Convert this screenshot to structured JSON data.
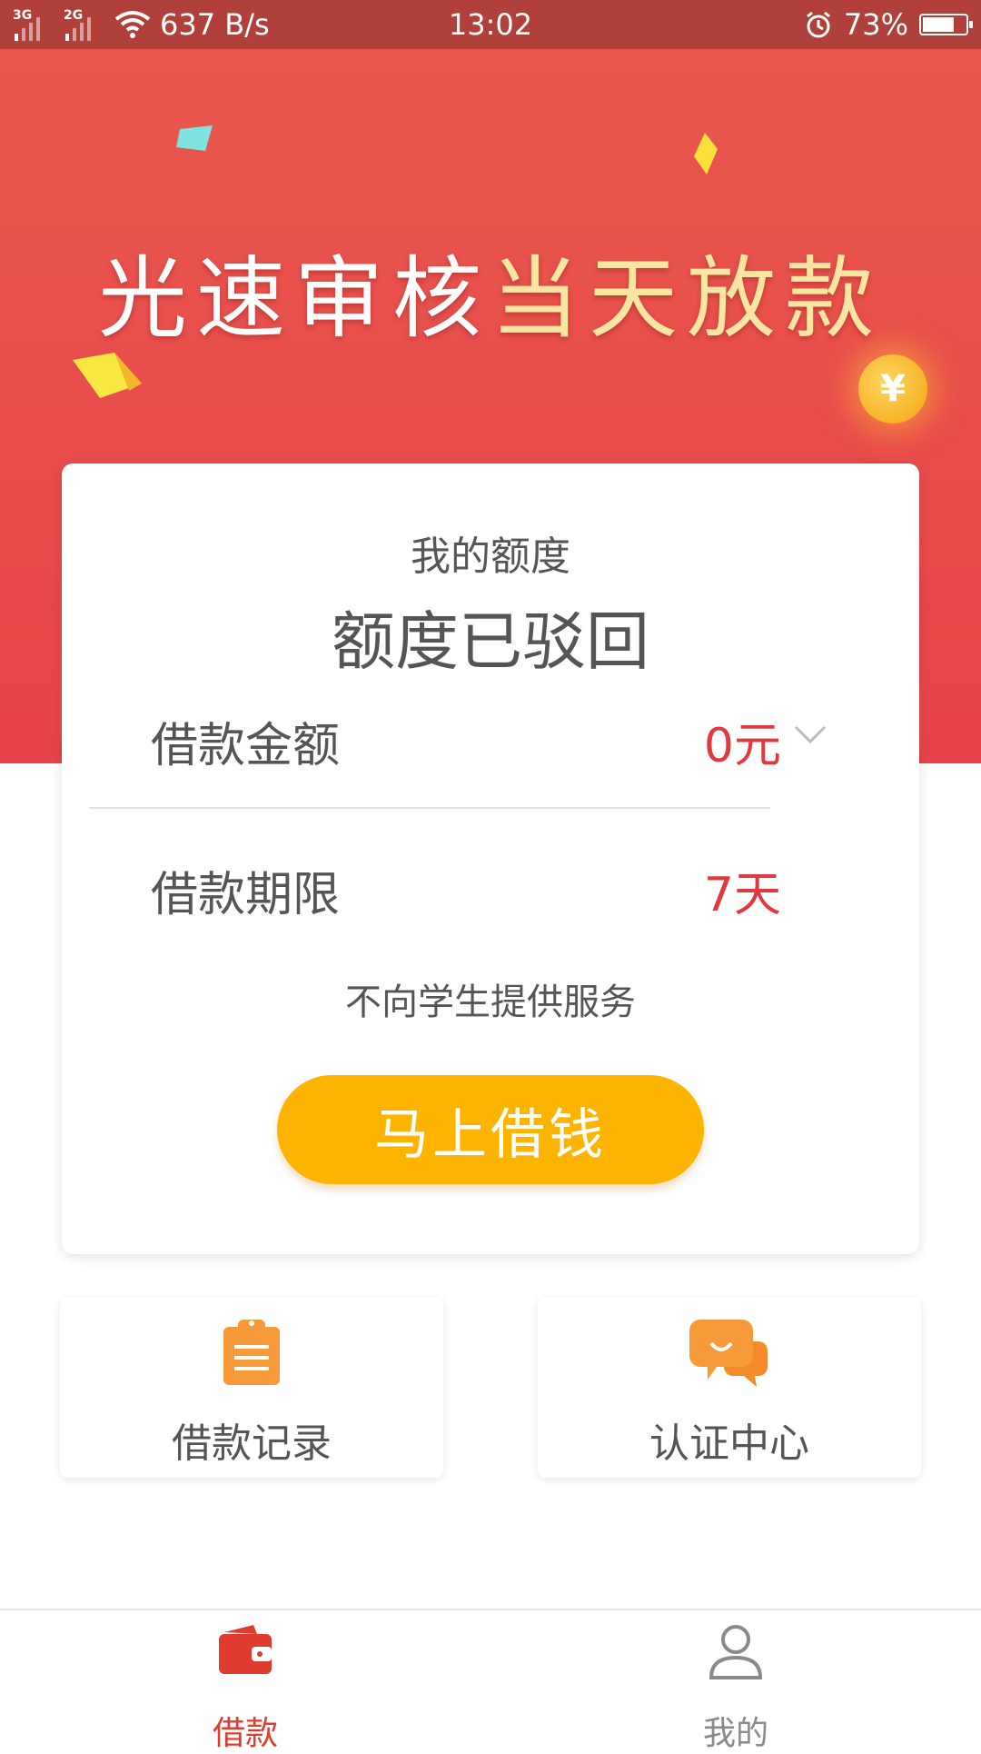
{
  "status_bar": {
    "network_a": "3G",
    "network_b": "2G",
    "speed": "637 B/s",
    "time": "13:02",
    "battery": "73%",
    "battery_level": 0.73
  },
  "hero": {
    "headline_white": "光速审核",
    "headline_gold": "当天放款",
    "coin_symbol": "¥"
  },
  "card": {
    "title": "我的额度",
    "status": "额度已驳回",
    "amount_label": "借款金额",
    "amount_value": "0元",
    "term_label": "借款期限",
    "term_value": "7天",
    "notice": "不向学生提供服务",
    "cta_label": "马上借钱"
  },
  "quick_links": [
    {
      "label": "借款记录",
      "icon": "clipboard-icon"
    },
    {
      "label": "认证中心",
      "icon": "chat-bubbles-icon"
    }
  ],
  "bottom_nav": [
    {
      "label": "借款",
      "icon": "wallet-icon",
      "active": true
    },
    {
      "label": "我的",
      "icon": "user-icon",
      "active": false
    }
  ],
  "colors": {
    "accent_red": "#e2383f",
    "cta_yellow": "#fdb400",
    "icon_orange": "#f79a3a",
    "nav_active": "#e03b2f"
  }
}
